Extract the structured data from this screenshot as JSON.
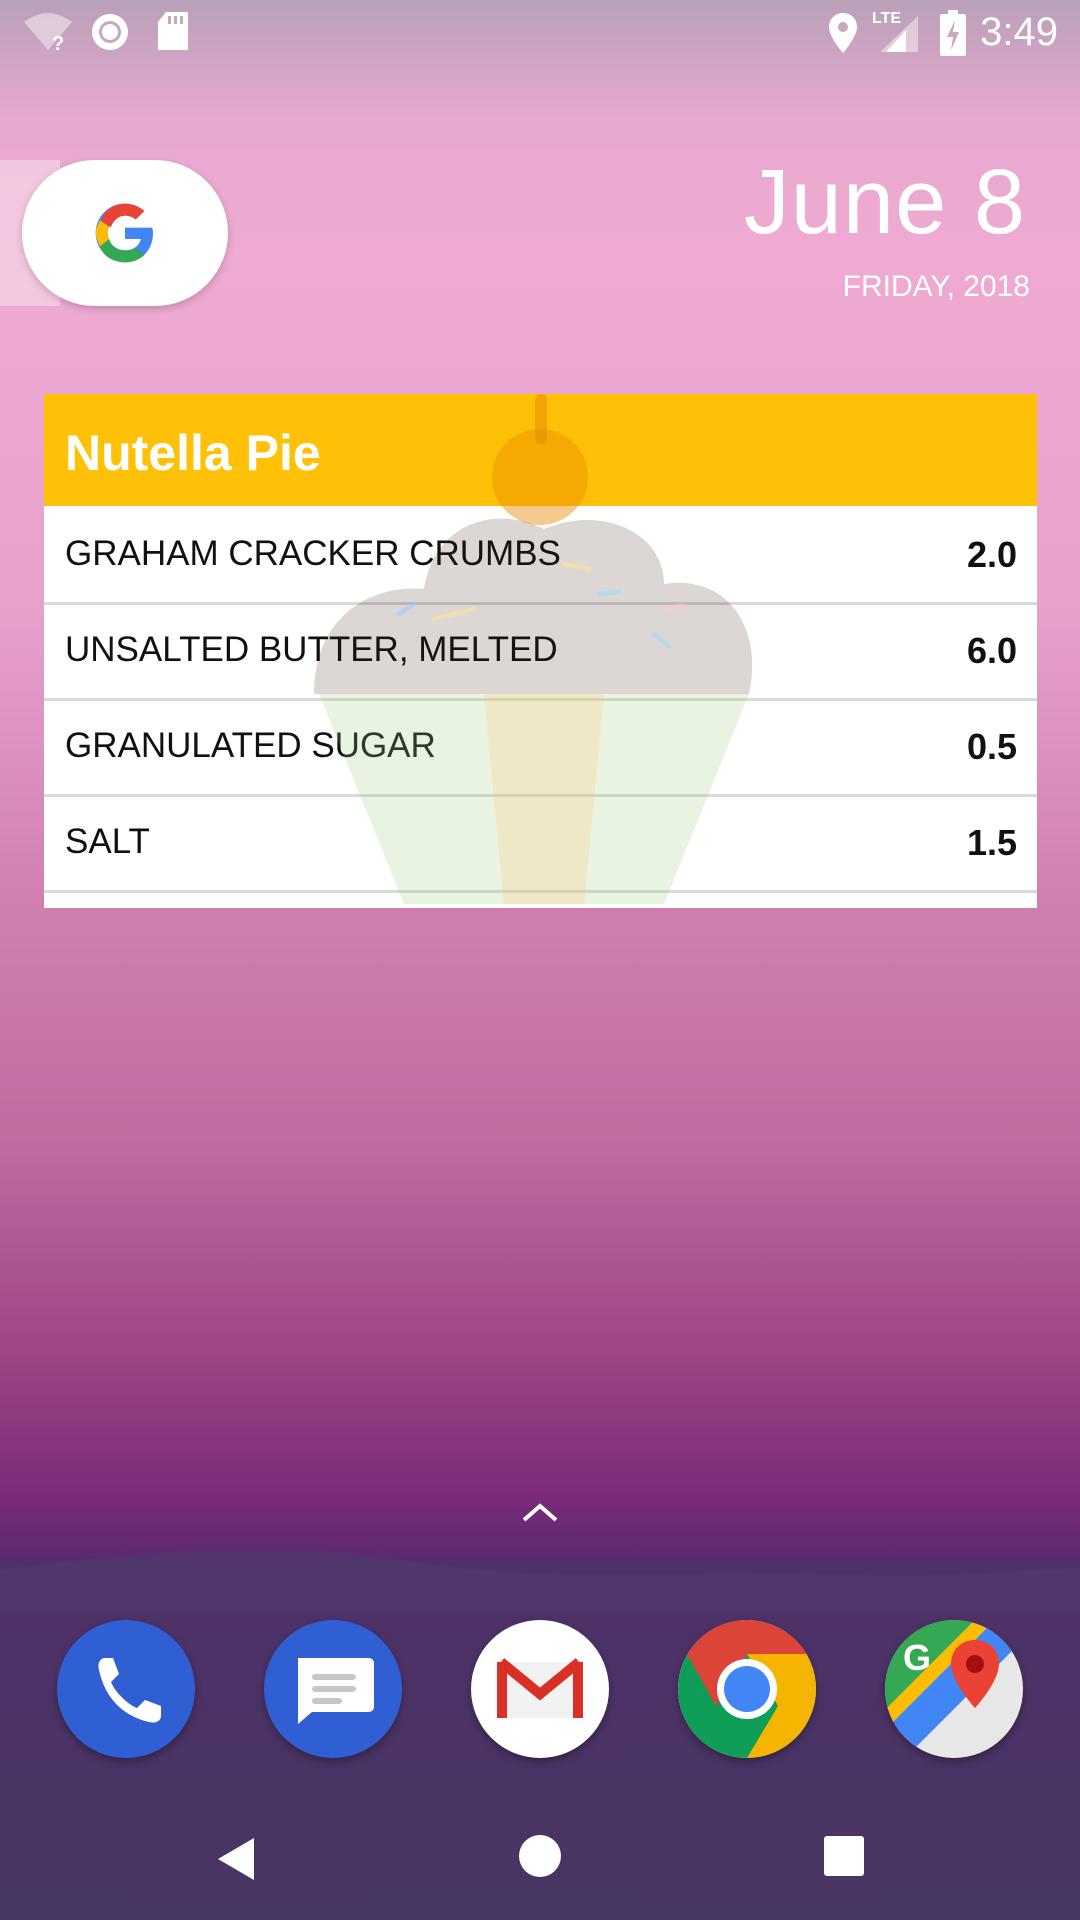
{
  "status_bar": {
    "time": "3:49",
    "network_label": "LTE",
    "icons": [
      "wifi-unknown-icon",
      "record-icon",
      "sd-card-icon",
      "location-icon",
      "signal-icon",
      "battery-charging-icon"
    ]
  },
  "date_widget": {
    "date": "June 8",
    "weekday_year": "FRIDAY, 2018"
  },
  "recipe_widget": {
    "title": "Nutella Pie",
    "header_color": "#FFC107",
    "ingredients": [
      {
        "name": "GRAHAM CRACKER CRUMBS",
        "qty": "2.0"
      },
      {
        "name": "UNSALTED BUTTER, MELTED",
        "qty": "6.0"
      },
      {
        "name": "GRANULATED SUGAR",
        "qty": "0.5"
      },
      {
        "name": "SALT",
        "qty": "1.5"
      }
    ]
  },
  "dock": {
    "apps": [
      "phone-icon",
      "messages-icon",
      "gmail-icon",
      "chrome-icon",
      "maps-icon"
    ]
  },
  "nav": {
    "buttons": [
      "back-icon",
      "home-icon",
      "recents-icon"
    ]
  }
}
